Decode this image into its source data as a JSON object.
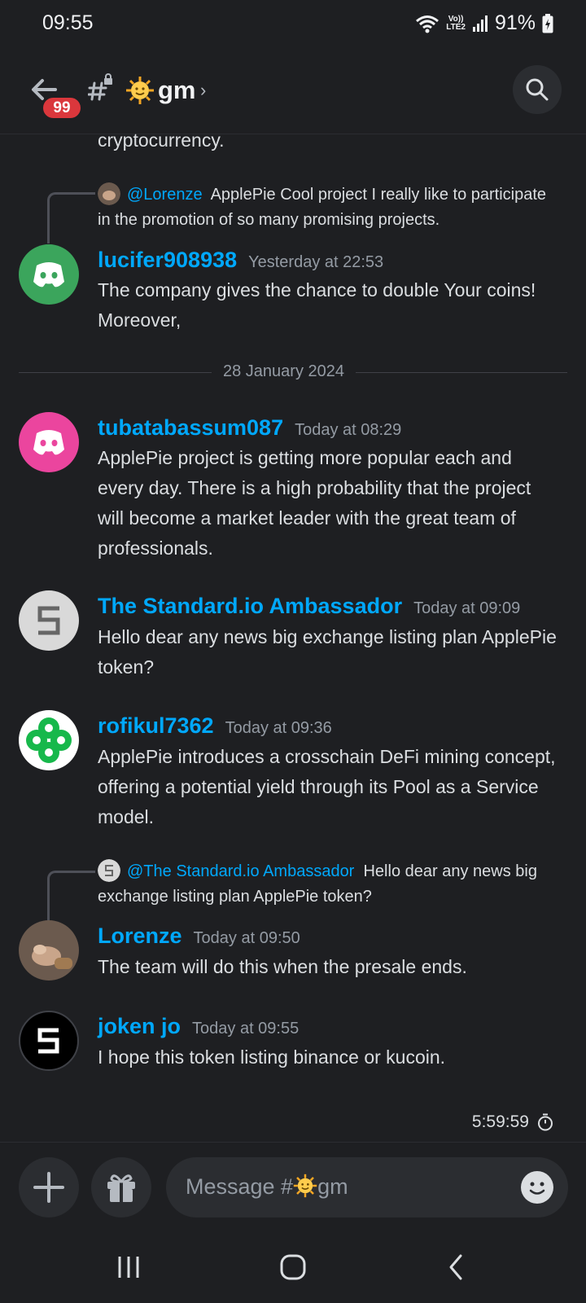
{
  "status": {
    "time": "09:55",
    "network_top": "Vo))",
    "network_bottom": "LTE2",
    "battery": "91%"
  },
  "header": {
    "unread_badge": "99",
    "channel_name": "gm",
    "channel_emoji": "sun-face-icon"
  },
  "messages": {
    "top_fragment": "cryptocurrency.",
    "reply1": {
      "user": "@Lorenze",
      "text": "ApplePie Cool project I really like to participate in the promotion of so many promising projects."
    },
    "m1": {
      "user": "lucifer908938",
      "time": "Yesterday at 22:53",
      "text": "The company gives the chance to double Your coins! Moreover,"
    },
    "date_divider": "28 January 2024",
    "m2": {
      "user": "tubatabassum087",
      "time": "Today at 08:29",
      "text": "ApplePie project is getting more popular each and every day. There is a high probability that the project will become a market leader with the great team of professionals."
    },
    "m3": {
      "user": "The Standard.io Ambassador",
      "time": "Today at 09:09",
      "text": "Hello dear any news big exchange listing plan ApplePie token?"
    },
    "m4": {
      "user": "rofikul7362",
      "time": "Today at 09:36",
      "text": "ApplePie introduces a crosschain DeFi mining concept, offering a potential yield through its Pool as a Service  model."
    },
    "reply2": {
      "user": "@The Standard.io Ambassador",
      "text": "Hello dear any news big exchange listing plan ApplePie token?"
    },
    "m5": {
      "user": "Lorenze",
      "time": "Today at 09:50",
      "text": "The team will do this when the presale ends."
    },
    "m6": {
      "user": "joken  jo",
      "time": "Today at 09:55",
      "text": "I hope this token listing binance or kucoin."
    }
  },
  "slowmode_timer": "5:59:59",
  "composer": {
    "placeholder_prefix": "Message #",
    "placeholder_channel": "gm"
  },
  "colors": {
    "accent": "#00a8fc",
    "background": "#1e1f22",
    "badge": "#da373c",
    "green_avatar": "#3ba55c",
    "pink_avatar": "#eb459e"
  }
}
